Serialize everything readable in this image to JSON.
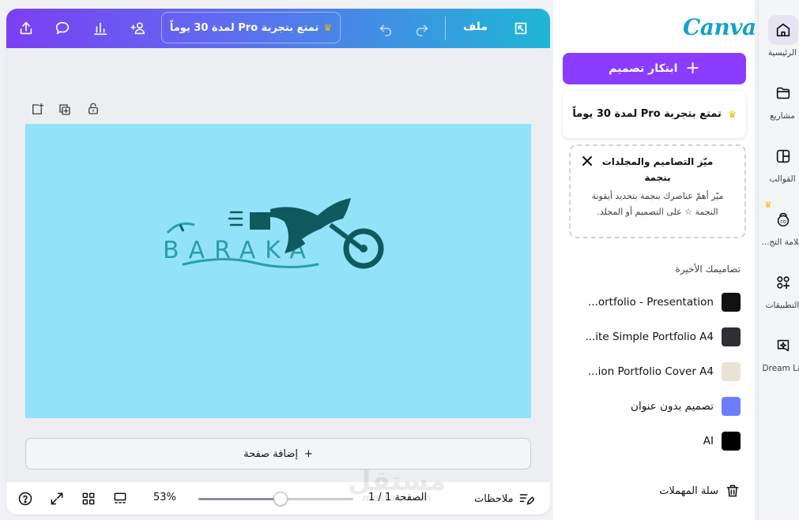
{
  "colors": {
    "accent": "#8b3dff",
    "canvas_bg": "#93e3f8",
    "brand": "#13a3c9",
    "logo_dark": "#0f5a5e",
    "logo_teal": "#2a9ea6",
    "crown": "#f5b800"
  },
  "topbar": {
    "file_label": "ملف",
    "trial_pill": "تمتع بتجربة Pro لمدة 30 يوماً",
    "icons": [
      "share-icon",
      "comment-icon",
      "analytics-icon",
      "add-people-icon",
      "crown-icon",
      "undo-icon",
      "redo-icon",
      "resize-icon"
    ]
  },
  "page": {
    "tool_icons": [
      "add-page-icon",
      "duplicate-page-icon",
      "lock-icon"
    ],
    "logo_text": "BARAKA",
    "add_page_label": "إضافة صفحة",
    "add_page_plus": "+"
  },
  "bottombar": {
    "notes_label": "ملاحظات",
    "page_count": "الصفحة 1 / 1",
    "zoom": "53%",
    "zoom_fraction": 0.53,
    "icons": [
      "help-icon",
      "fullscreen-icon",
      "grid-view-icon",
      "thumbnail-view-icon",
      "notes-icon"
    ]
  },
  "panel": {
    "brand": "Canva",
    "create_button": "ابتكار تصميم",
    "create_plus": "+",
    "trial_card": "تمتع بتجربة Pro لمدة 30 يوماً",
    "star_card": {
      "title": "ميّز التصاميم والمجلدات بنجمة",
      "body": "ميّز أهمّ عناصرك بنجمة بتحديد أيقونة النجمة ☆ على التصميم أو المجلد."
    },
    "recent_heading": "تصاميمك الأخيرة",
    "recent": [
      {
        "label": "...ortfolio - Presentation",
        "thumb": "#111111"
      },
      {
        "label": "...ite Simple Portfolio A4",
        "thumb": "#2d2f33"
      },
      {
        "label": "...ion Portfolio Cover A4",
        "thumb": "#e9e3d6"
      },
      {
        "label": "تصميم بدون عنوان",
        "thumb": "#6c7cff",
        "rtl": true
      },
      {
        "label": "AI",
        "thumb": "#000000"
      }
    ],
    "trash_label": "سلة المهملات"
  },
  "rail": {
    "items": [
      {
        "label": "الرئيسية",
        "icon": "home-icon",
        "active": true
      },
      {
        "label": "مشاريع",
        "icon": "folder-icon"
      },
      {
        "label": "القوالب",
        "icon": "templates-icon"
      },
      {
        "label": "علامة التج...",
        "icon": "brand-icon",
        "crown": true
      },
      {
        "label": "التطبيقات",
        "icon": "apps-icon"
      },
      {
        "label": "Dream La",
        "icon": "dream-lab-icon"
      }
    ]
  },
  "watermark": {
    "text": "مستقل",
    "sub": "mostaql.com"
  }
}
